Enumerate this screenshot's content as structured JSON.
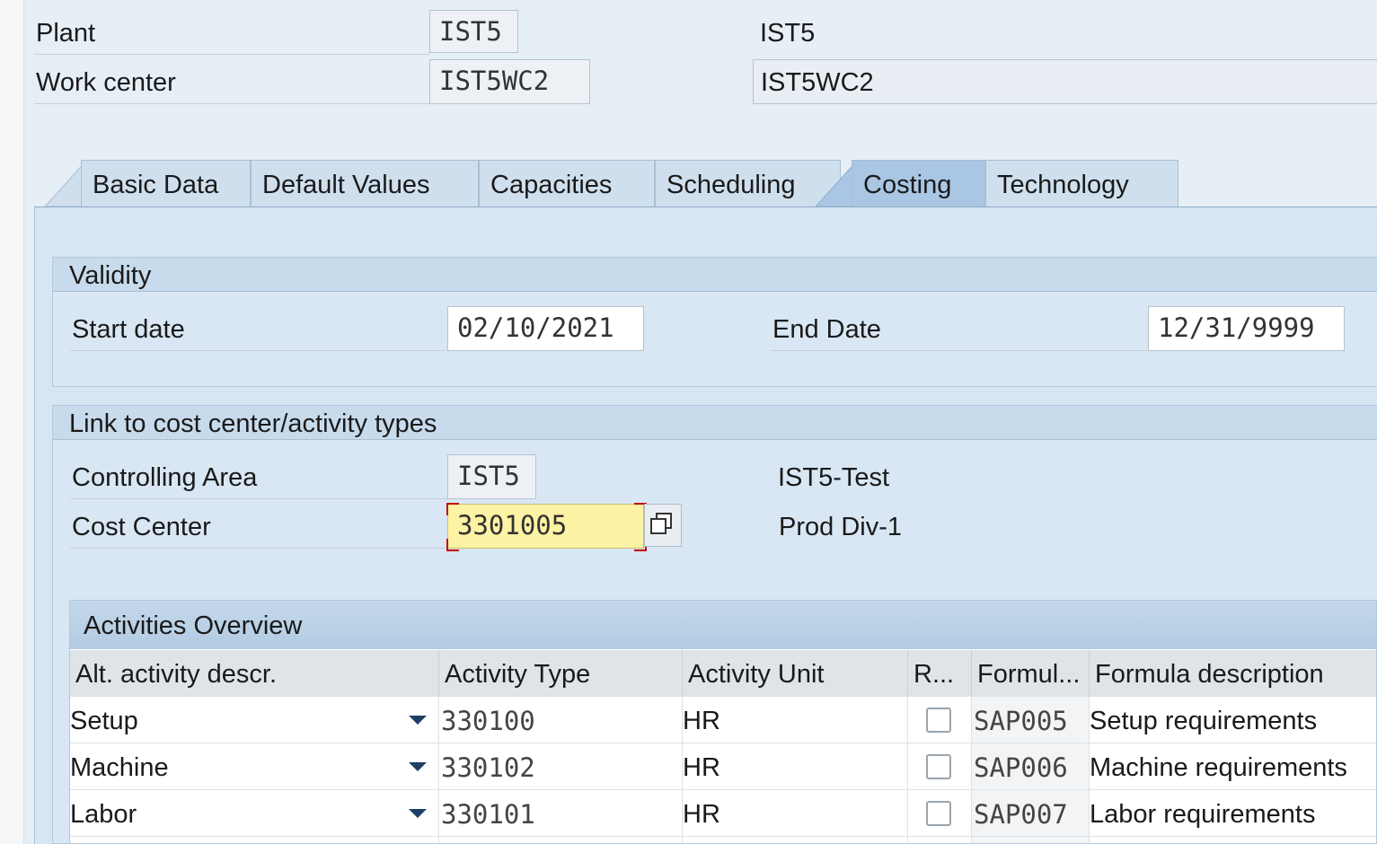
{
  "header": {
    "plant_label": "Plant",
    "plant_value": "IST5",
    "plant_text": "IST5",
    "work_center_label": "Work center",
    "work_center_value": "IST5WC2",
    "work_center_text": "IST5WC2"
  },
  "tabs": [
    {
      "label": "Basic Data",
      "active": false
    },
    {
      "label": "Default Values",
      "active": false
    },
    {
      "label": "Capacities",
      "active": false
    },
    {
      "label": "Scheduling",
      "active": false
    },
    {
      "label": "Costing",
      "active": true
    },
    {
      "label": "Technology",
      "active": false
    }
  ],
  "validity": {
    "title": "Validity",
    "start_label": "Start date",
    "start_value": "02/10/2021",
    "end_label": "End Date",
    "end_value": "12/31/9999"
  },
  "link": {
    "title": "Link to cost center/activity types",
    "controlling_area_label": "Controlling Area",
    "controlling_area_value": "IST5",
    "controlling_area_text": "IST5-Test",
    "cost_center_label": "Cost Center",
    "cost_center_value": "3301005",
    "cost_center_text": "Prod Div-1"
  },
  "activities": {
    "title": "Activities Overview",
    "columns": [
      "Alt. activity descr.",
      "Activity Type",
      "Activity Unit",
      "R...",
      "Formul...",
      "Formula description"
    ],
    "rows": [
      {
        "descr": "Setup",
        "type": "330100",
        "unit": "HR",
        "checked": false,
        "formula": "SAP005",
        "formula_desc": "Setup requirements"
      },
      {
        "descr": "Machine",
        "type": "330102",
        "unit": "HR",
        "checked": false,
        "formula": "SAP006",
        "formula_desc": "Machine requirements"
      },
      {
        "descr": "Labor",
        "type": "330101",
        "unit": "HR",
        "checked": false,
        "formula": "SAP007",
        "formula_desc": "Labor requirements"
      }
    ]
  },
  "colors": {
    "active_tab": "#a9c7e4",
    "required_field": "#fdf3a4",
    "required_border": "#c00000"
  }
}
